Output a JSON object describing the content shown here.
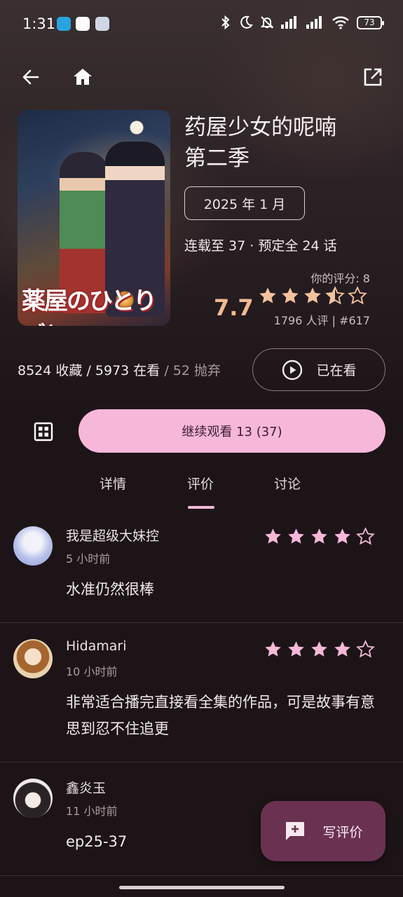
{
  "status_bar": {
    "time": "1:31",
    "battery": "73",
    "icons": [
      "telegram-icon",
      "app-icon",
      "app-icon",
      "bluetooth-icon",
      "moon-icon",
      "bell-off-icon",
      "signal-icon",
      "signal-icon",
      "wifi-icon",
      "battery-icon"
    ]
  },
  "nav": {
    "back_icon": "arrow-left-icon",
    "home_icon": "home-icon",
    "external_icon": "open-external-icon"
  },
  "anime": {
    "title_line1": "药屋少女的呢喃",
    "title_line2": "第二季",
    "air_date": "2025 年 1 月",
    "episodes": "连载至 37 · 预定全 24 话",
    "my_score": "你的评分: 8",
    "score": "7.7",
    "score_stars": 3.5,
    "score_meta": "1796 人评 | #617",
    "poster_logo": "薬屋のひとりごと"
  },
  "stats": {
    "favorites": "8524 收藏",
    "sep1": " / ",
    "watching": "5973 在看",
    "sep2": " / ",
    "dropped": "52 抛弃"
  },
  "actions": {
    "watch_status": "已在看",
    "continue": "继续观看 13 (37)"
  },
  "tabs": {
    "details": "详情",
    "reviews": "评价",
    "discussion": "讨论",
    "active": "评价"
  },
  "reviews": [
    {
      "user": "我是超级大妹控",
      "time": "5 小时前",
      "text": "水准仍然很棒",
      "stars": 4
    },
    {
      "user": "Hidamari",
      "time": "10 小时前",
      "text": "非常适合播完直接看全集的作品，可是故事有意思到忍不住追更",
      "stars": 4
    },
    {
      "user": "鑫炎玉",
      "time": "11 小时前",
      "text": "ep25-37",
      "stars": null
    }
  ],
  "fab": {
    "label": "写评价",
    "icon": "add-comment-icon"
  },
  "colors": {
    "accent": "#f7b7d8",
    "score": "#f3b990",
    "fab": "#6a3250",
    "background": "#1d1418"
  }
}
